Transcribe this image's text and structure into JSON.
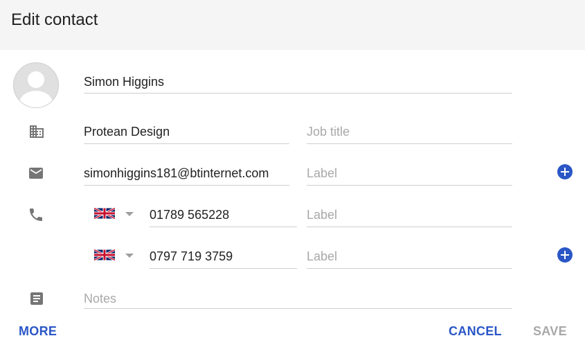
{
  "dialog": {
    "title": "Edit contact"
  },
  "contact": {
    "name": "Simon Higgins",
    "company": "Protean Design",
    "job_title_placeholder": "Job title",
    "email": "simonhiggins181@btinternet.com",
    "email_label_placeholder": "Label",
    "phones": [
      {
        "country": "UK",
        "number": "01789 565228",
        "label_placeholder": "Label"
      },
      {
        "country": "UK",
        "number": "0797 719 3759",
        "label_placeholder": "Label"
      }
    ],
    "notes_placeholder": "Notes"
  },
  "icons": {
    "company": "building-icon",
    "email": "envelope-icon",
    "phone": "phone-icon",
    "notes": "notes-icon",
    "add": "add-circle-icon",
    "flag": "uk-flag-icon",
    "caret": "dropdown-caret-icon"
  },
  "footer": {
    "more_label": "MORE",
    "cancel_label": "CANCEL",
    "save_label": "SAVE"
  },
  "colors": {
    "accent": "#2a56c6",
    "header_bg": "#f5f5f5",
    "icon_gray": "#757575",
    "placeholder": "#a8a8a8"
  }
}
